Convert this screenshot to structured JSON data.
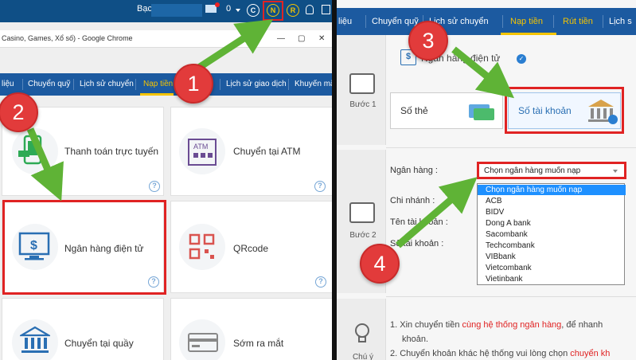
{
  "left": {
    "topbar": {
      "balance_label": "Bạc",
      "notif_count": "0",
      "coin_c": "C",
      "coin_n": "N",
      "coin_r": "R"
    },
    "chrome": {
      "title": "Casino, Games, Xổ số) - Google Chrome",
      "min": "—",
      "max": "▢",
      "close": "✕"
    },
    "nav": [
      "liệu",
      "Chuyển quỹ",
      "Lịch sử chuyển",
      "Nạp tiền",
      "Lịch sử giao dịch",
      "Khuyến mã"
    ],
    "nav_active_index": 3,
    "tiles": [
      {
        "label": "Thanh toán trực tuyến"
      },
      {
        "label": "Chuyển tại ATM",
        "icon_text": "ATM"
      },
      {
        "label": "Ngân hàng điện tử"
      },
      {
        "label": "QRcode"
      },
      {
        "label": "Chuyển tại quầy"
      },
      {
        "label": "Sớm ra mắt"
      }
    ],
    "help_glyph": "?",
    "dollar_glyph": "$"
  },
  "right": {
    "nav": [
      "liệu",
      "Chuyển quỹ",
      "Lịch sử chuyển",
      "Nạp tiền",
      "Rút tiền",
      "Lịch s"
    ],
    "nav_active_index": 3,
    "step1": {
      "label": "Bước 1",
      "title": "Ngân hàng điện tử",
      "opt_card": "Số thẻ",
      "opt_account": "Số tài khoản"
    },
    "step2": {
      "label": "Bước 2",
      "bank_label": "Ngân hàng :",
      "branch_label": "Chi nhánh :",
      "name_label": "Tên tài khoản :",
      "account_label": "Số tài khoản :",
      "select_value": "Chọn ngân hàng muốn nạp",
      "options": [
        "Chọn ngân hàng muốn nạp",
        "ACB",
        "BIDV",
        "Dong A bank",
        "Sacombank",
        "Techcombank",
        "VIBbank",
        "Vietcombank",
        "Vietinbank"
      ]
    },
    "notes": {
      "label": "Chú ý",
      "n1_a": "1. Xin chuyển tiền ",
      "n1_b": "cùng hệ thống ngân hàng",
      "n1_c": ", để nhanh",
      "n1_d": "khoản.",
      "n2_a": "2. Chuyển khoản khác hệ thống vui lòng chọn ",
      "n2_b": "chuyển kh"
    }
  },
  "badges": [
    "1",
    "2",
    "3",
    "4"
  ],
  "colors": {
    "highlight": "#e02323",
    "nav_blue": "#1c5aa0",
    "active_yellow": "#f5c400",
    "arrow_green": "#5fb336",
    "badge_red": "#e23b3b"
  }
}
